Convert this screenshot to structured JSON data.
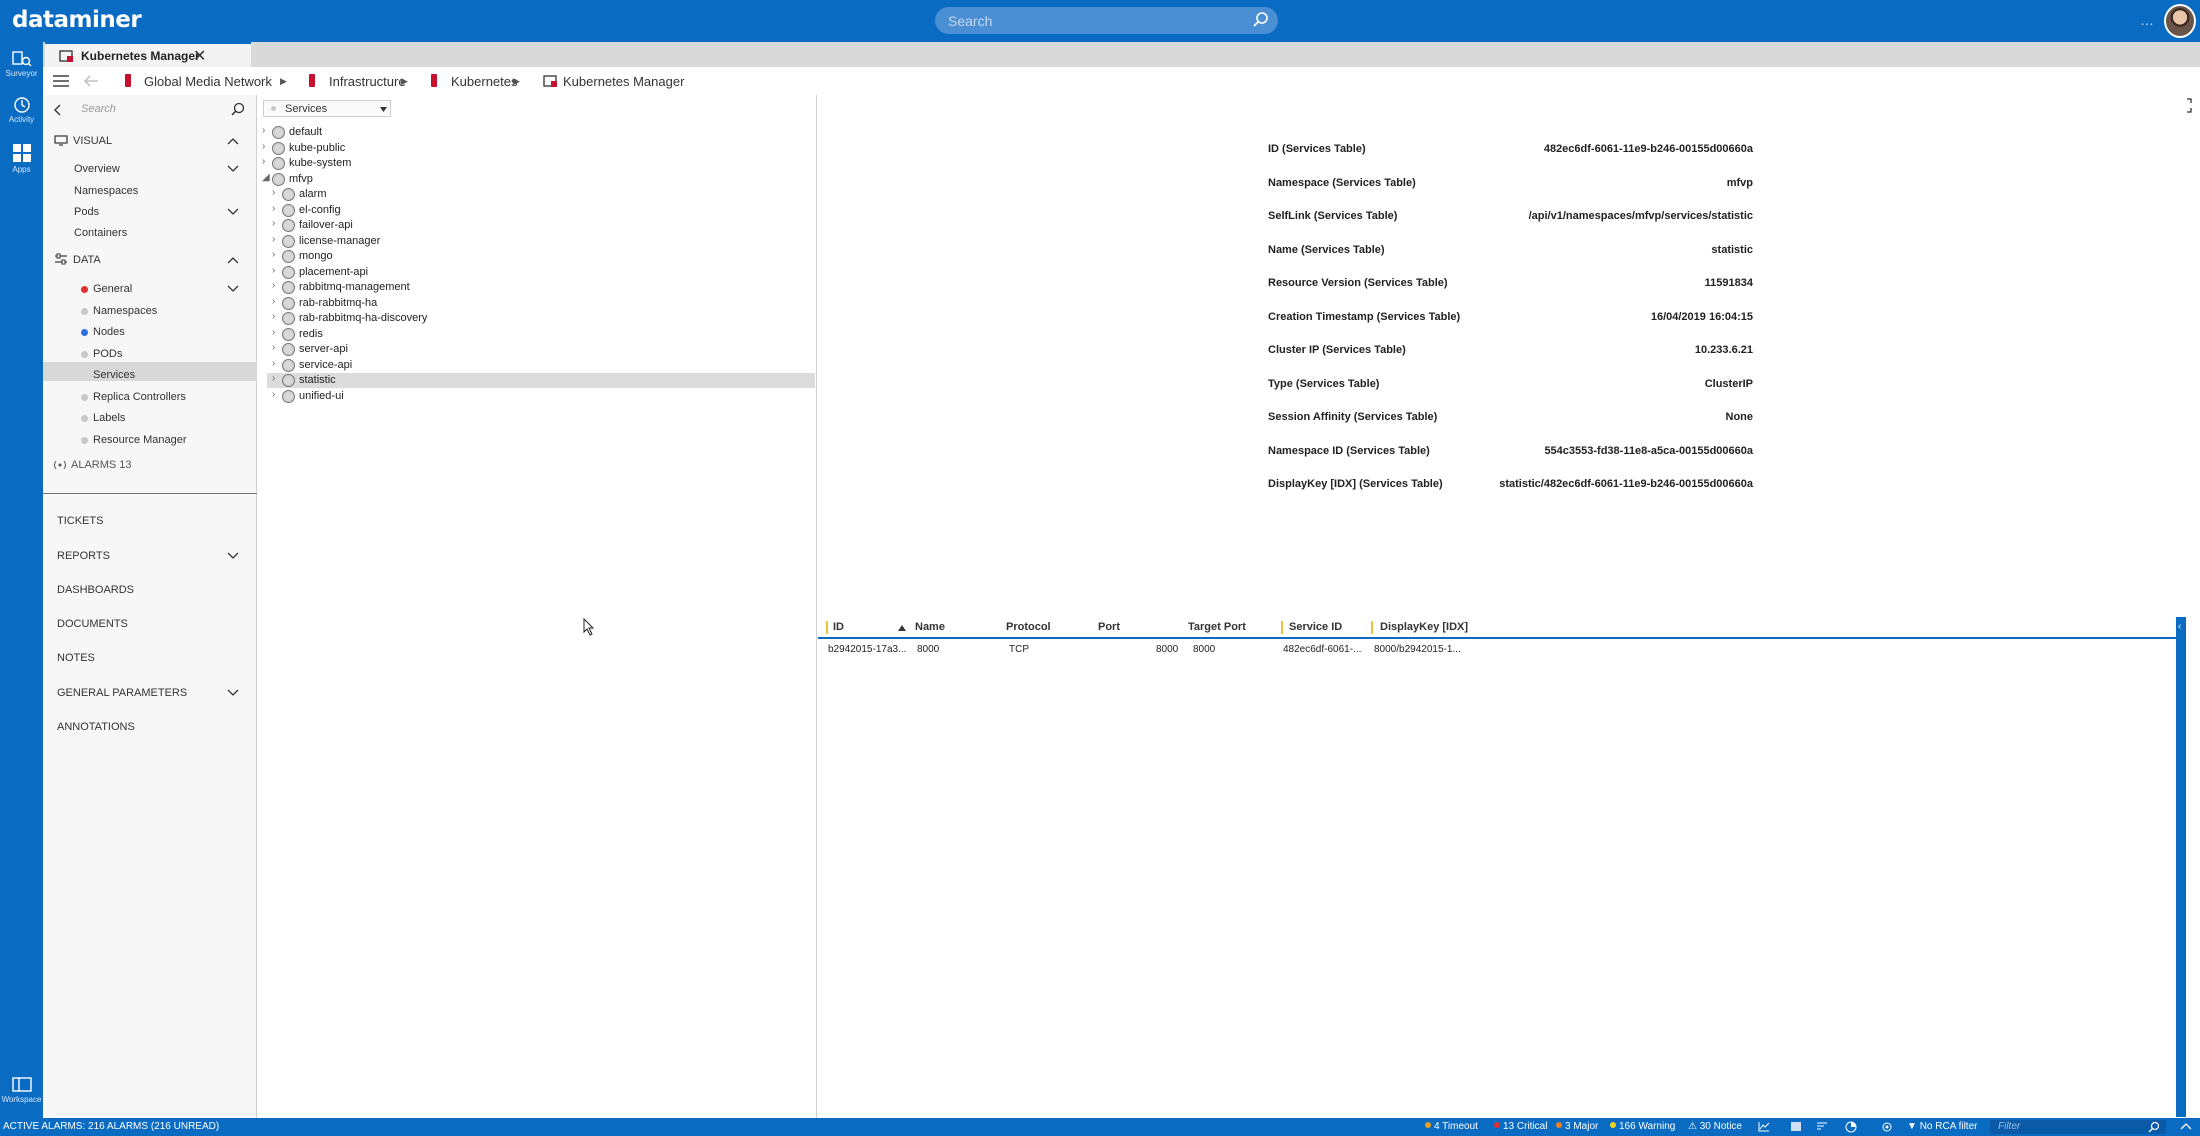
{
  "app": {
    "logo": "dataminer",
    "search_placeholder": "Search",
    "top_menu": "…",
    "accent": "#0a6bc2"
  },
  "rail": {
    "items": [
      {
        "label": "Surveyor",
        "icon": "surveyor-icon"
      },
      {
        "label": "Activity",
        "icon": "activity-icon"
      },
      {
        "label": "Apps",
        "icon": "apps-icon"
      }
    ],
    "workspace": "Workspace"
  },
  "tab": {
    "title": "Kubernetes Manager",
    "close": "✕"
  },
  "breadcrumb": [
    {
      "label": "Global Media Network"
    },
    {
      "label": "Infrastructure"
    },
    {
      "label": "Kubernetes"
    },
    {
      "label": "Kubernetes Manager"
    }
  ],
  "left": {
    "search_placeholder": "Search",
    "visual": {
      "title": "VISUAL",
      "items": [
        "Overview",
        "Namespaces",
        "Pods",
        "Containers"
      ]
    },
    "data": {
      "title": "DATA",
      "items": [
        {
          "label": "General",
          "status": "#e03030"
        },
        {
          "label": "Namespaces",
          "status": "#c8c8c8"
        },
        {
          "label": "Nodes",
          "status": "#2f6fe0"
        },
        {
          "label": "PODs",
          "status": "#c8c8c8"
        },
        {
          "label": "Services",
          "status": "#c8c8c8"
        },
        {
          "label": "Replica Controllers",
          "status": "#c8c8c8"
        },
        {
          "label": "Labels",
          "status": "#c8c8c8"
        },
        {
          "label": "Resource Manager",
          "status": "#c8c8c8"
        }
      ],
      "selected": "Services"
    },
    "alarms": "ALARMS 13",
    "modules": [
      "TICKETS",
      "REPORTS",
      "DASHBOARDS",
      "DOCUMENTS",
      "NOTES",
      "GENERAL PARAMETERS",
      "ANNOTATIONS"
    ]
  },
  "tree": {
    "dropdown_value": "Services",
    "namespaces": [
      "default",
      "kube-public",
      "kube-system",
      "mfvp"
    ],
    "mfvp_children": [
      "alarm",
      "el-config",
      "failover-api",
      "license-manager",
      "mongo",
      "placement-api",
      "rabbitmq-management",
      "rab-rabbitmq-ha",
      "rab-rabbitmq-ha-discovery",
      "redis",
      "server-api",
      "service-api",
      "statistic",
      "unified-ui"
    ],
    "selected": "statistic"
  },
  "details": [
    {
      "key": "ID (Services Table)",
      "value": "482ec6df-6061-11e9-b246-00155d00660a"
    },
    {
      "key": "Namespace (Services Table)",
      "value": "mfvp"
    },
    {
      "key": "SelfLink (Services Table)",
      "value": "/api/v1/namespaces/mfvp/services/statistic"
    },
    {
      "key": "Name (Services Table)",
      "value": "statistic"
    },
    {
      "key": "Resource Version (Services Table)",
      "value": "11591834"
    },
    {
      "key": "Creation Timestamp (Services Table)",
      "value": "16/04/2019 16:04:15"
    },
    {
      "key": "Cluster IP (Services Table)",
      "value": "10.233.6.21"
    },
    {
      "key": "Type (Services Table)",
      "value": "ClusterIP"
    },
    {
      "key": "Session Affinity (Services Table)",
      "value": "None"
    },
    {
      "key": "Namespace ID (Services Table)",
      "value": "554c3553-fd38-11e8-a5ca-00155d00660a"
    },
    {
      "key": "DisplayKey [IDX] (Services Table)",
      "value": "statistic/482ec6df-6061-11e9-b246-00155d00660a"
    }
  ],
  "grid": {
    "columns": [
      "ID",
      "Name",
      "Protocol",
      "Port",
      "Target Port",
      "Service ID",
      "DisplayKey [IDX]"
    ],
    "rows": [
      [
        "b2942015-17a3...",
        "8000",
        "TCP",
        "8000",
        "8000",
        "482ec6df-6061-...",
        "8000/b2942015-1..."
      ]
    ]
  },
  "status": {
    "active_alarms": "ACTIVE ALARMS: 216 ALARMS (216 UNREAD)",
    "counts": [
      {
        "label": "4 Timeout",
        "color": "#f0a020"
      },
      {
        "label": "13 Critical",
        "color": "#e03030"
      },
      {
        "label": "3 Major",
        "color": "#f08020"
      },
      {
        "label": "166 Warning",
        "color": "#f0d020"
      },
      {
        "label": "30 Notice",
        "color": "#f0d020"
      }
    ],
    "rca": "No RCA filter",
    "filter_placeholder": "Filter"
  }
}
